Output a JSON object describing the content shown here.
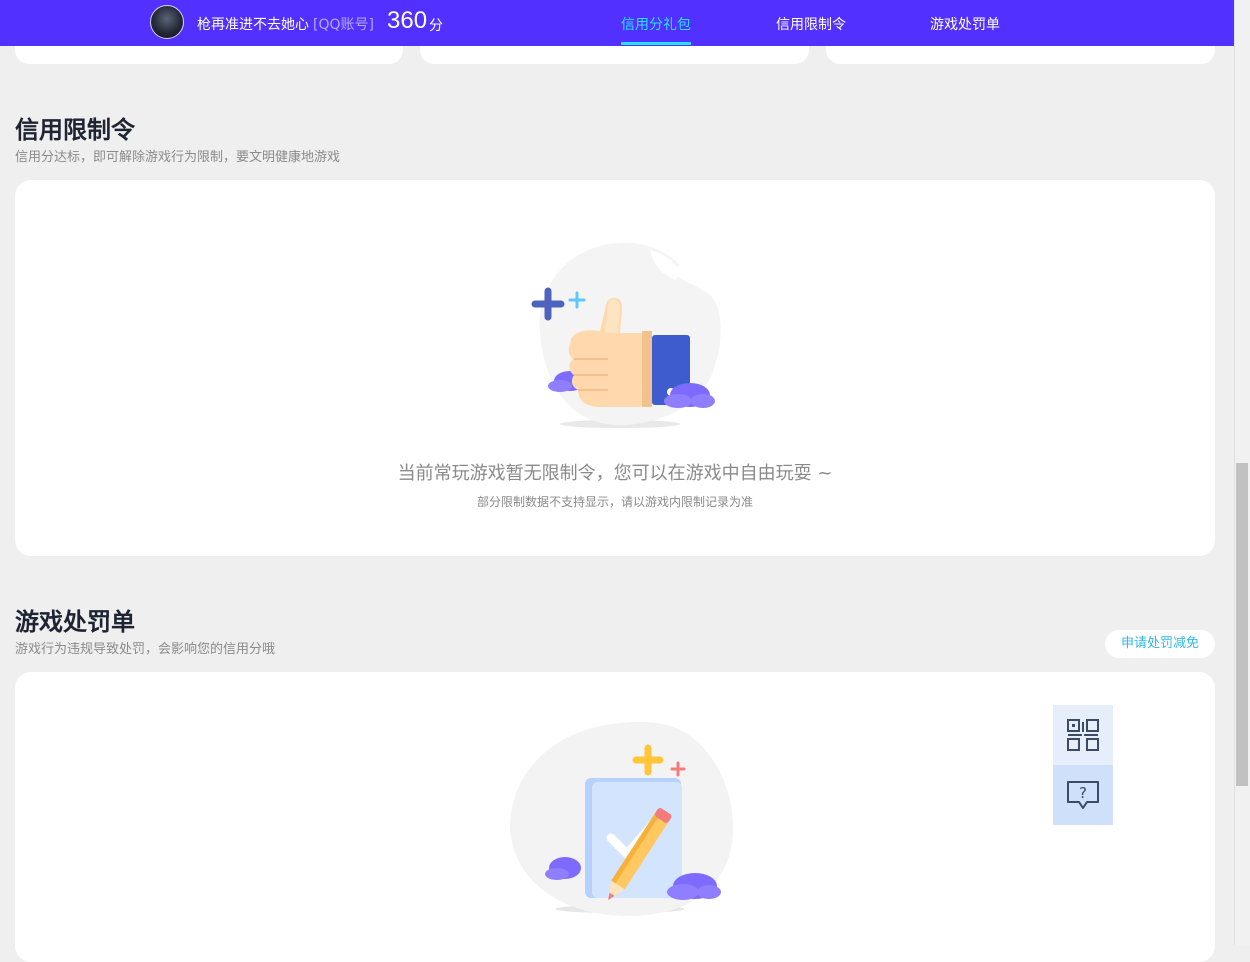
{
  "header": {
    "username": "枪再准进不去她心",
    "account_tag": "[QQ账号]",
    "score": "360",
    "score_unit": "分",
    "tabs": [
      {
        "label": "信用分礼包",
        "active": true
      },
      {
        "label": "信用限制令",
        "active": false
      },
      {
        "label": "游戏处罚单",
        "active": false
      }
    ]
  },
  "restriction": {
    "title": "信用限制令",
    "subtitle": "信用分达标，即可解除游戏行为限制，要文明健康地游戏",
    "empty_text": "当前常玩游戏暂无限制令，您可以在游戏中自由玩耍 ~",
    "empty_note": "部分限制数据不支持显示，请以游戏内限制记录为准",
    "illustration_icon": "thumbs-up-icon"
  },
  "penalty": {
    "title": "游戏处罚单",
    "subtitle": "游戏行为违规导致处罚，会影响您的信用分哦",
    "apply_button": "申请处罚减免",
    "illustration_icon": "clipboard-check-icon"
  },
  "floating": {
    "qr_icon": "qr-code-icon",
    "help_icon": "help-chat-icon"
  },
  "colors": {
    "header_bg": "#5230ff",
    "tab_active": "#28e3ff",
    "apply_text": "#2fb8e6",
    "page_bg": "#efefef"
  }
}
